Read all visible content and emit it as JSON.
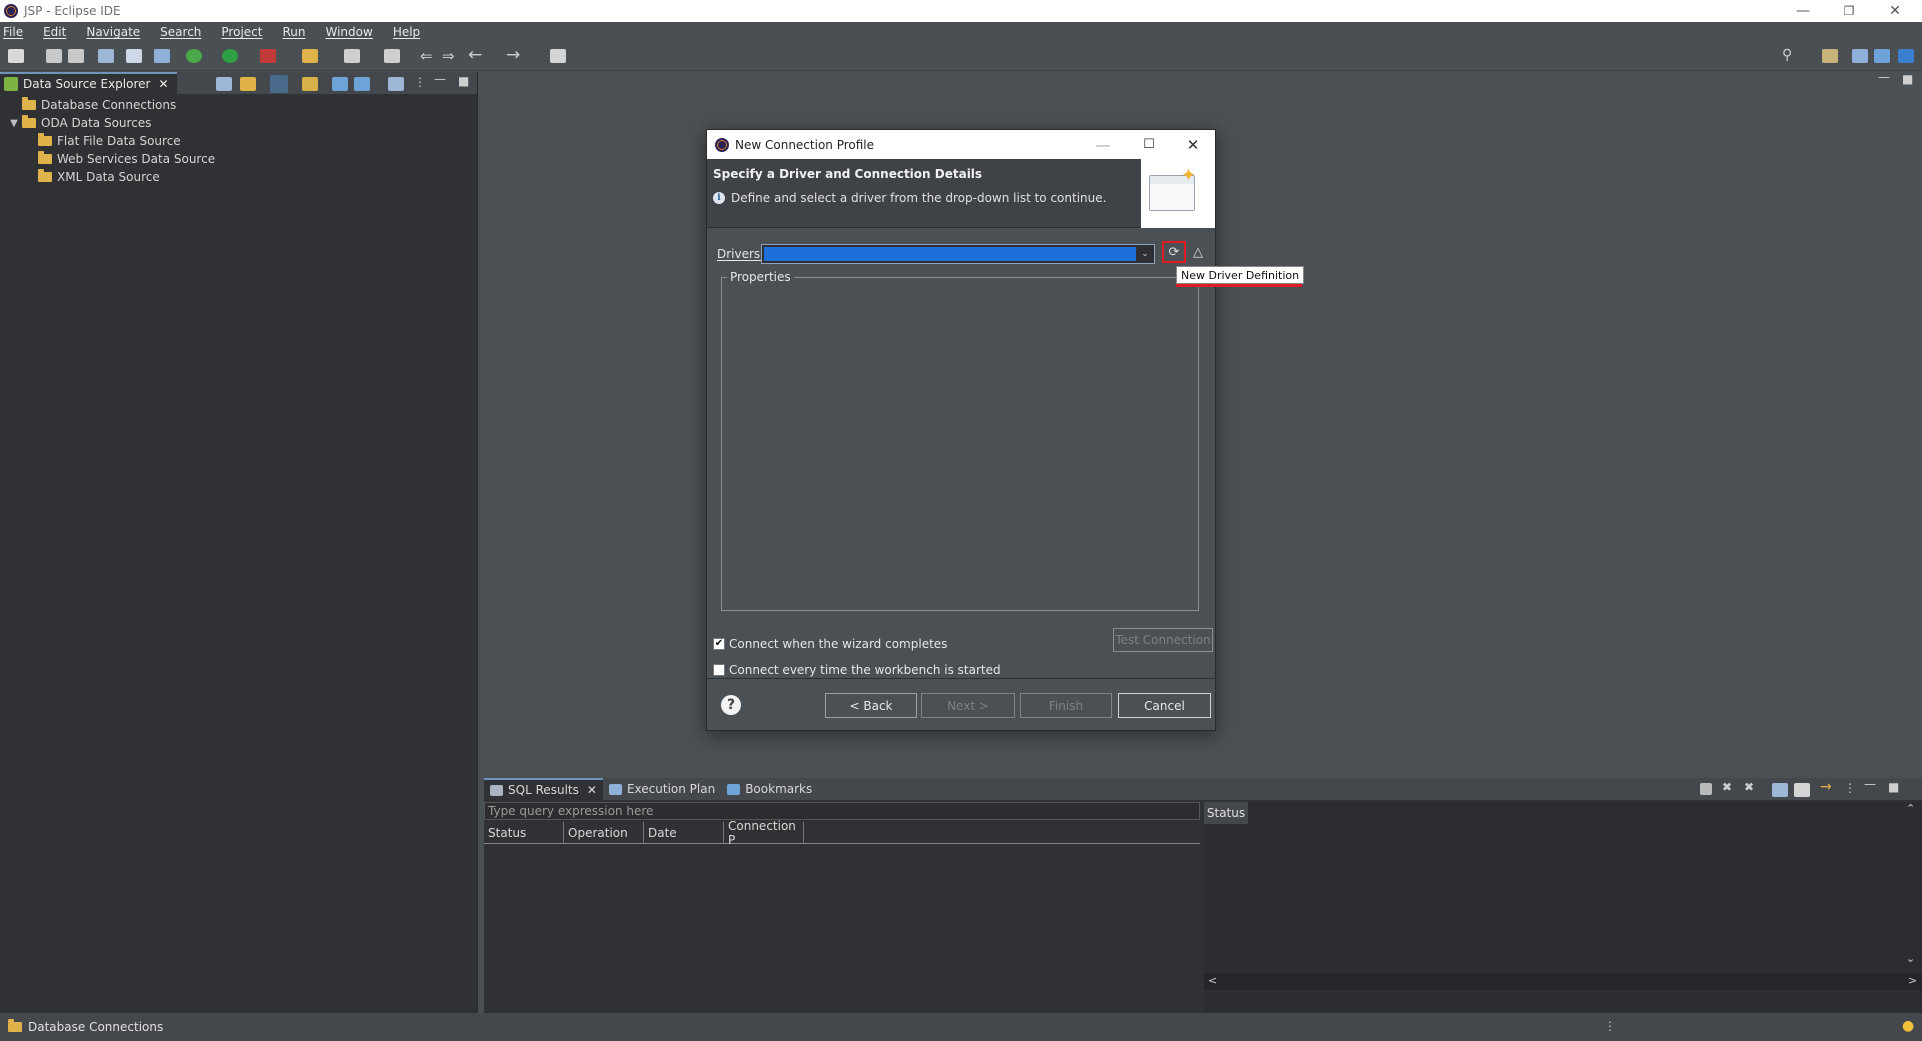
{
  "window": {
    "title": "JSP - Eclipse IDE"
  },
  "menu": [
    "File",
    "Edit",
    "Navigate",
    "Search",
    "Project",
    "Run",
    "Window",
    "Help"
  ],
  "left_panel": {
    "tab_label": "Data Source Explorer",
    "tree": [
      {
        "label": "Database Connections",
        "level": 0,
        "expand": ""
      },
      {
        "label": "ODA Data Sources",
        "level": 0,
        "expand": "expanded"
      },
      {
        "label": "Flat File Data Source",
        "level": 1,
        "expand": ""
      },
      {
        "label": "Web Services Data Source",
        "level": 1,
        "expand": ""
      },
      {
        "label": "XML Data Source",
        "level": 1,
        "expand": ""
      }
    ]
  },
  "dialog": {
    "title": "New Connection Profile",
    "banner_title": "Specify a Driver and Connection Details",
    "banner_message": "Define and select a driver from the drop-down list to continue.",
    "drivers_label": "Drivers:",
    "drivers_value": "",
    "tooltip": "New Driver Definition",
    "properties_label": "Properties",
    "connect_on_finish_label": "Connect when the wizard completes",
    "connect_on_finish_checked": true,
    "connect_on_startup_label": "Connect every time the workbench is started",
    "connect_on_startup_checked": false,
    "test_connection_label": "Test Connection",
    "back_label": "< Back",
    "next_label": "Next >",
    "finish_label": "Finish",
    "cancel_label": "Cancel"
  },
  "bottom_panel": {
    "tabs": [
      "SQL Results",
      "Execution Plan",
      "Bookmarks"
    ],
    "query_placeholder": "Type query expression here",
    "columns": [
      "Status",
      "Operation",
      "Date",
      "Connection P"
    ],
    "status_header": "Status"
  },
  "statusbar": {
    "selection": "Database Connections"
  },
  "colors": {
    "background": "#4a4f53",
    "panel": "#2f3134",
    "selection": "#1e6fd9",
    "highlight": "#e01b24",
    "folder": "#e0b24a"
  }
}
